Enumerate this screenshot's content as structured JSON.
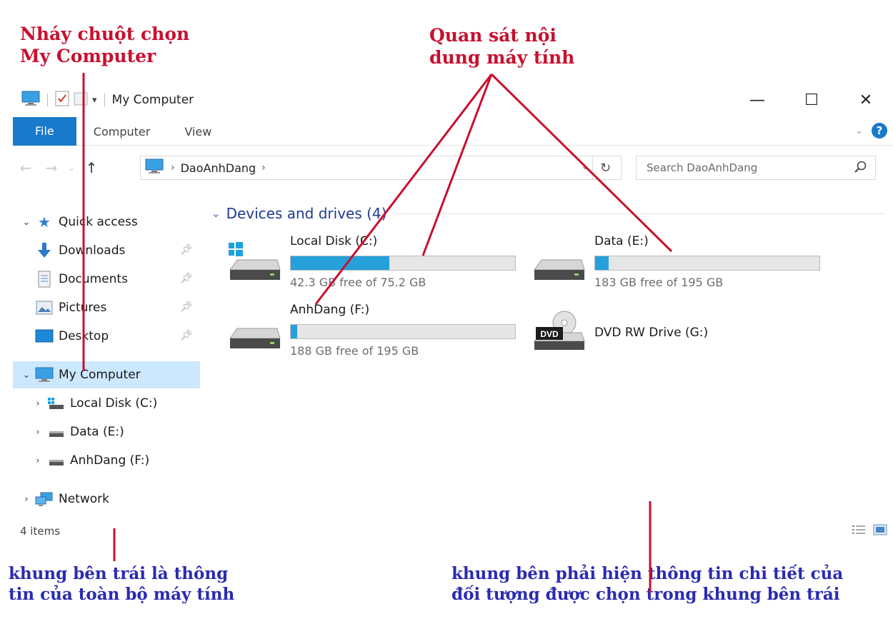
{
  "annotations": {
    "top_left": [
      "Nháy chuột chọn",
      "My Computer"
    ],
    "top_center": [
      "Quan sát nội",
      "dung máy tính"
    ],
    "bottom_left": [
      "khung bên trái là thông",
      "tin của toàn bộ máy tính"
    ],
    "bottom_right": [
      "khung bên phải hiện thông tin chi tiết của",
      "đối tượng được chọn trong khung bên trái"
    ]
  },
  "window": {
    "title": "My Computer",
    "icons": [
      "computer-icon",
      "properties-icon",
      "new-folder-icon",
      "dropdown-icon"
    ],
    "controls": {
      "minimize": "—",
      "maximize": "☐",
      "close": "✕"
    }
  },
  "ribbon": {
    "tabs": [
      {
        "label": "File",
        "active": true
      },
      {
        "label": "Computer",
        "active": false
      },
      {
        "label": "View",
        "active": false
      }
    ]
  },
  "address": {
    "crumbs": [
      "DaoAnhDang"
    ],
    "search_placeholder": "Search DaoAnhDang"
  },
  "sidebar": {
    "quick_access": {
      "label": "Quick access",
      "items": [
        {
          "label": "Downloads",
          "icon": "download-icon",
          "pinned": true
        },
        {
          "label": "Documents",
          "icon": "documents-icon",
          "pinned": true
        },
        {
          "label": "Pictures",
          "icon": "pictures-icon",
          "pinned": true
        },
        {
          "label": "Desktop",
          "icon": "desktop-icon",
          "pinned": true
        }
      ]
    },
    "my_computer": {
      "label": "My Computer",
      "selected": true,
      "items": [
        {
          "label": "Local Disk (C:)",
          "icon": "windows-drive-icon"
        },
        {
          "label": "Data (E:)",
          "icon": "drive-icon"
        },
        {
          "label": "AnhDang (F:)",
          "icon": "drive-icon"
        }
      ]
    },
    "network": {
      "label": "Network",
      "icon": "network-icon"
    }
  },
  "content": {
    "group_label": "Devices and drives (4)",
    "drives": [
      {
        "name": "Local Disk (C:)",
        "free_text": "42.3 GB free of 75.2 GB",
        "used_fraction": 0.44,
        "icon": "windows-drive-icon"
      },
      {
        "name": "Data (E:)",
        "free_text": "183 GB free of 195 GB",
        "used_fraction": 0.06,
        "icon": "drive-icon"
      },
      {
        "name": "AnhDang (F:)",
        "free_text": "188 GB free of 195 GB",
        "used_fraction": 0.03,
        "icon": "drive-icon"
      },
      {
        "name": "DVD RW Drive (G:)",
        "free_text": "",
        "used_fraction": null,
        "icon": "dvd-drive-icon",
        "icon_label": "DVD"
      }
    ]
  },
  "status": {
    "count": "4 items"
  },
  "colors": {
    "annotation_red": "#c8102e",
    "annotation_blue": "#2a2bb0",
    "accent": "#1979ca",
    "bar_fill": "#26a0da",
    "selected_bg": "#cce8ff"
  }
}
